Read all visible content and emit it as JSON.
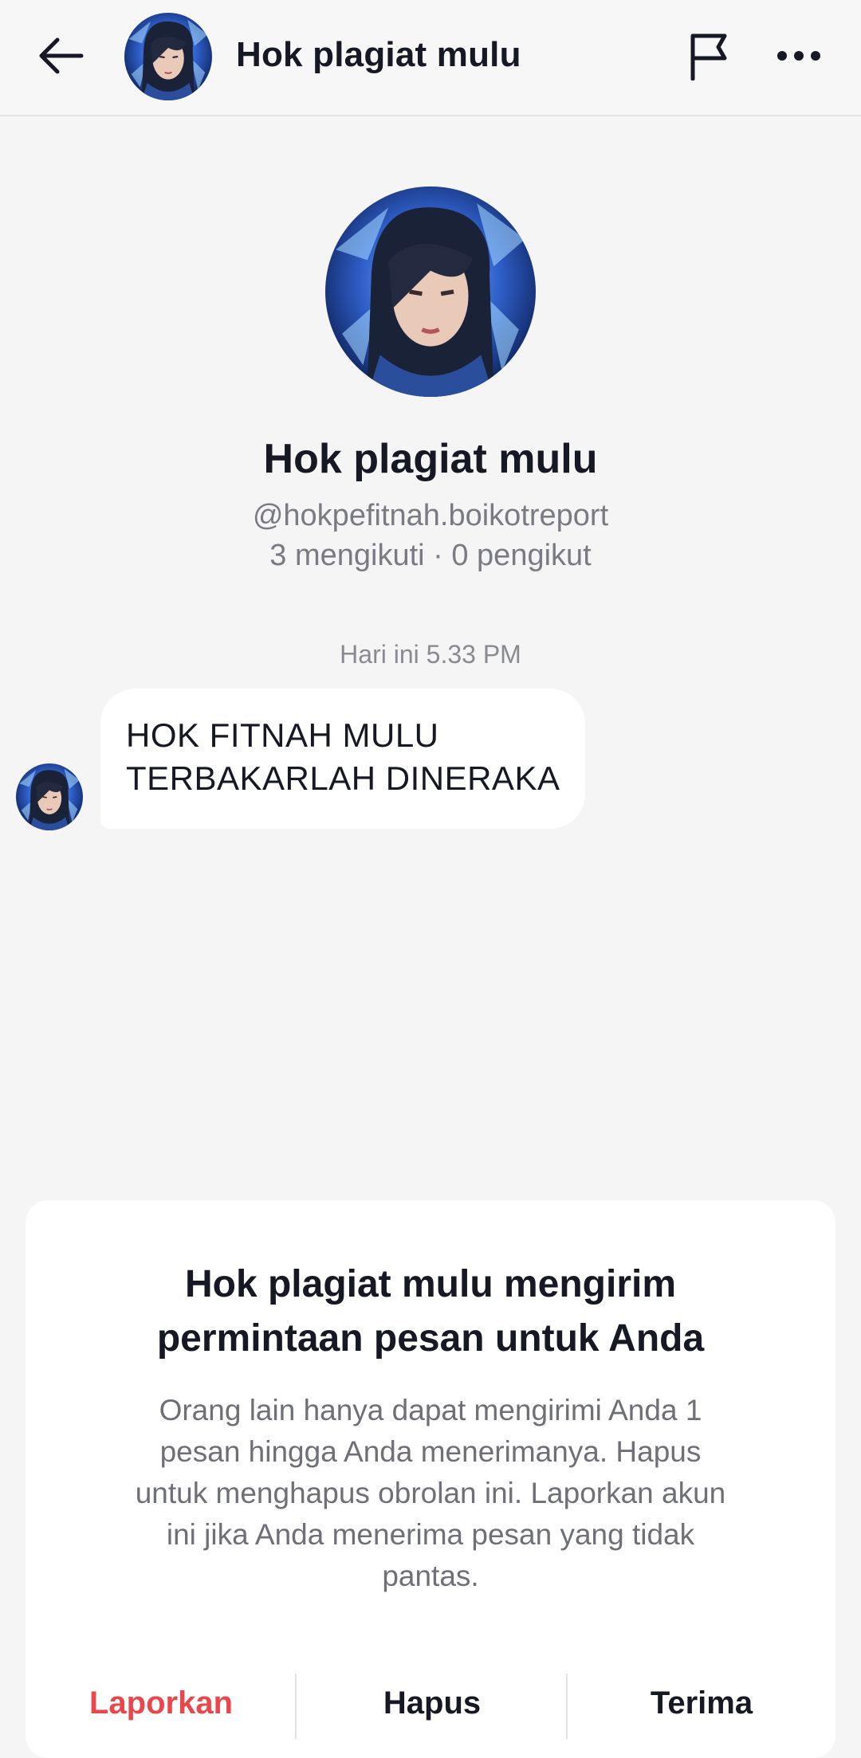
{
  "header": {
    "title": "Hok plagiat mulu",
    "icons": {
      "back": "arrow-left-icon",
      "report": "flag-icon",
      "more": "more-horizontal-icon"
    }
  },
  "profile": {
    "name": "Hok plagiat mulu",
    "handle": "@hokpefitnah.boikotreport",
    "stats": "3 mengikuti · 0 pengikut"
  },
  "chat": {
    "timestamp": "Hari ini 5.33 PM",
    "messages": [
      {
        "lines": [
          "HOK FITNAH MULU",
          "TERBAKARLAH DINERAKA"
        ]
      }
    ]
  },
  "request": {
    "title_line1": "Hok plagiat mulu mengirim",
    "title_line2": "permintaan pesan untuk Anda",
    "description_lines": [
      "Orang lain hanya dapat mengirimi Anda 1",
      "pesan hingga Anda menerimanya. Hapus",
      "untuk menghapus obrolan ini. Laporkan akun",
      "ini jika Anda menerima pesan yang tidak",
      "pantas."
    ],
    "report_label": "Laporkan",
    "delete_label": "Hapus",
    "accept_label": "Terima"
  },
  "colors": {
    "background": "#f5f5f6",
    "report": "#e8474b",
    "text_primary": "#161823",
    "text_secondary": "#7a7b82"
  }
}
